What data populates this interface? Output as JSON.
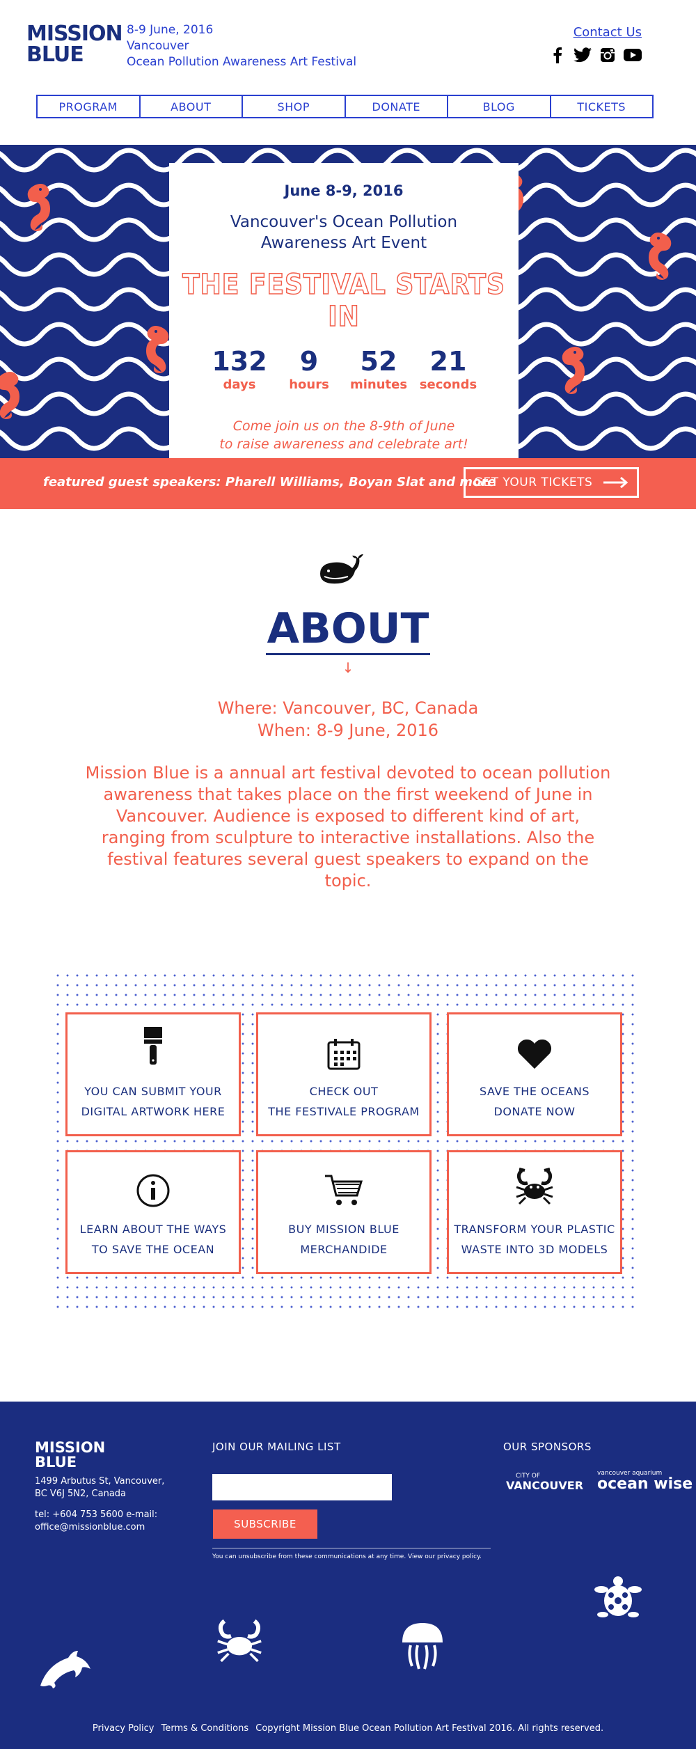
{
  "header": {
    "logo_line1": "MISSION",
    "logo_line2": "BLUE",
    "info_date": "8-9 June, 2016",
    "info_city": "Vancouver",
    "info_event": "Ocean Pollution Awareness Art Festival",
    "contact_label": "Contact Us"
  },
  "socials": [
    {
      "icon": "facebook-icon"
    },
    {
      "icon": "twitter-icon"
    },
    {
      "icon": "instagram-icon"
    },
    {
      "icon": "youtube-icon"
    }
  ],
  "nav": {
    "items": [
      {
        "label": "PROGRAM"
      },
      {
        "label": "ABOUT"
      },
      {
        "label": "SHOP"
      },
      {
        "label": "DONATE"
      },
      {
        "label": "BLOG"
      },
      {
        "label": "TICKETS"
      }
    ]
  },
  "hero": {
    "date": "June 8-9, 2016",
    "title_line1": "Vancouver's Ocean Pollution",
    "title_line2": "Awareness Art Event",
    "starts": "THE FESTIVAL STARTS IN",
    "countdown": [
      {
        "num": "132",
        "label": "days"
      },
      {
        "num": "9",
        "label": "hours"
      },
      {
        "num": "52",
        "label": "minutes"
      },
      {
        "num": "21",
        "label": "seconds"
      }
    ],
    "invite_line1": "Come join us on the 8-9th of June",
    "invite_line2": "to raise awareness and celebrate art!"
  },
  "banner": {
    "text": "featured guest speakers: Pharell Williams, Boyan Slat and more",
    "button": "GET YOUR TICKETS"
  },
  "about": {
    "title": "ABOUT",
    "arrow": "↓",
    "where": "Where: Vancouver, BC, Canada",
    "when": "When: 8-9 June, 2016",
    "description": "Mission Blue is a annual art festival devoted to ocean pollution awareness that takes place on the first weekend of June in Vancouver. Audience is exposed to different kind of art, ranging from sculpture to interactive installations. Also the festival features several guest speakers to expand on the topic."
  },
  "cards": [
    {
      "icon": "paintbrush-icon",
      "line1": "YOU CAN SUBMIT YOUR",
      "line2": "DIGITAL ARTWORK HERE"
    },
    {
      "icon": "calendar-icon",
      "line1": "CHECK OUT",
      "line2": "THE FESTIVALE PROGRAM"
    },
    {
      "icon": "heart-icon",
      "line1": "SAVE THE OCEANS",
      "line2": "DONATE NOW"
    },
    {
      "icon": "info-icon",
      "line1": "LEARN ABOUT THE WAYS",
      "line2": "TO SAVE THE OCEAN"
    },
    {
      "icon": "cart-icon",
      "line1": "BUY MISSION BLUE",
      "line2": "MERCHANDIDE"
    },
    {
      "icon": "crab-icon",
      "line1": "TRANSFORM YOUR PLASTIC",
      "line2": "WASTE INTO 3D MODELS"
    }
  ],
  "footer": {
    "logo_line1": "MISSION",
    "logo_line2": "BLUE",
    "address_line1": "1499 Arbutus St, Vancouver,",
    "address_line2": "BC V6J 5N2, Canada",
    "contact_line": "tel: +604 753 5600 e-mail: office@missionblue.com",
    "mailing_title": "JOIN OUR MAILING LIST",
    "email_value": "",
    "subscribe": "SUBSCRIBE",
    "unsubscribe_note": "You can unsubscribe from these communications at any time. View our privacy policy.",
    "sponsors_title": "OUR SPONSORS",
    "sponsor1_small": "CITY OF",
    "sponsor1_big": "VANCOUVER",
    "sponsor2_small": "vancouver aquarium",
    "sponsor2_big": "ocean wise",
    "legal_privacy": "Privacy Policy",
    "legal_terms": "Terms & Conditions",
    "legal_copyright": "Copyright Mission Blue Ocean Pollution Art Festival 2016. All rights reserved."
  },
  "colors": {
    "navy": "#1b2d80",
    "coral": "#f25f4c",
    "link_blue": "#2a40d0"
  }
}
